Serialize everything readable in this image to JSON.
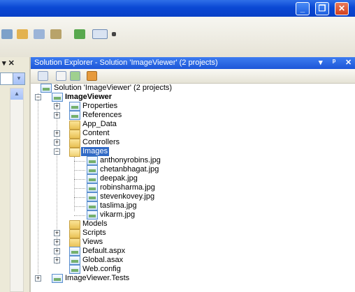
{
  "panel": {
    "title": "Solution Explorer - Solution 'ImageViewer' (2 projects)",
    "title_controls": [
      "▾",
      "ᵖ",
      "✕"
    ]
  },
  "left_panel": {
    "header_glyphs": "▾ ✕",
    "combo_arrow": "▾",
    "scroll_up": "▴"
  },
  "window_controls": [
    "_",
    "❐",
    "✕"
  ],
  "tree": {
    "solution": "Solution 'ImageViewer' (2 projects)",
    "project": "ImageViewer",
    "items": {
      "properties": "Properties",
      "references": "References",
      "app_data": "App_Data",
      "content": "Content",
      "controllers": "Controllers",
      "images": "Images",
      "image_files": [
        "anthonyrobins.jpg",
        "chetanbhagat.jpg",
        "deepak.jpg",
        "robinsharma.jpg",
        "stevenkovey.jpg",
        "taslima.jpg",
        "vikarm.jpg"
      ],
      "models": "Models",
      "scripts": "Scripts",
      "views": "Views",
      "default": "Default.aspx",
      "global": "Global.asax",
      "webconfig": "Web.config"
    },
    "tests_project": "ImageViewer.Tests"
  },
  "colors": {
    "title_blue": "#1c56d8",
    "selection": "#316ac5",
    "folder": "#e9c155"
  }
}
